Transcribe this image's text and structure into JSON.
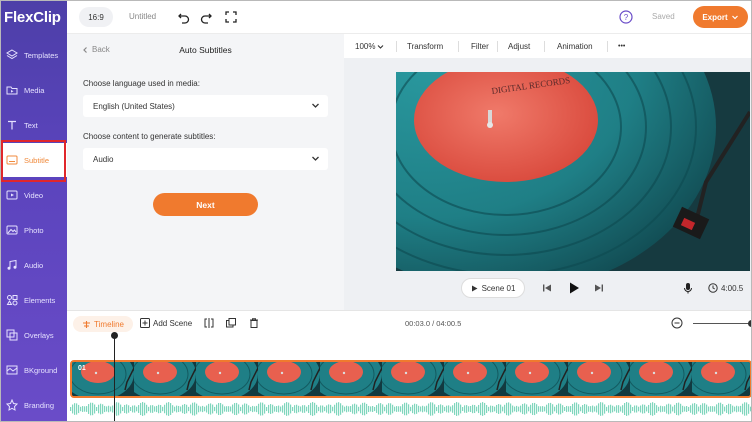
{
  "app": {
    "logo_text": "FlexClip"
  },
  "sidebar": {
    "items": [
      {
        "label": "Templates",
        "icon": "layers-icon"
      },
      {
        "label": "Media",
        "icon": "folder-icon"
      },
      {
        "label": "Text",
        "icon": "text-icon"
      },
      {
        "label": "Subtitle",
        "icon": "subtitle-icon",
        "active": true
      },
      {
        "label": "Video",
        "icon": "video-icon"
      },
      {
        "label": "Photo",
        "icon": "photo-icon"
      },
      {
        "label": "Audio",
        "icon": "music-icon"
      },
      {
        "label": "Elements",
        "icon": "elements-icon"
      },
      {
        "label": "Overlays",
        "icon": "overlays-icon"
      },
      {
        "label": "BKground",
        "icon": "background-icon"
      },
      {
        "label": "Branding",
        "icon": "branding-icon"
      }
    ]
  },
  "topbar": {
    "ratio": "16:9",
    "project_title": "Untitled",
    "saved_label": "Saved",
    "export_label": "Export"
  },
  "panel": {
    "back_label": "Back",
    "title": "Auto Subtitles",
    "language_label": "Choose language used in media:",
    "language_value": "English (United States)",
    "content_label": "Choose content to generate subtitles:",
    "content_value": "Audio",
    "next_label": "Next"
  },
  "preview_tools": {
    "zoom": "100%",
    "transform": "Transform",
    "filter": "Filter",
    "adjust": "Adjust",
    "animation": "Animation",
    "more": "•••"
  },
  "preview": {
    "record_label_text": "DIGITAL RECORDS",
    "scene_label": "Scene 01",
    "duration": "4:00.5"
  },
  "timeline": {
    "timeline_label": "Timeline",
    "add_scene_label": "Add Scene",
    "time_readout": "00:03.0 / 04:00.5",
    "clip_number": "01"
  },
  "colors": {
    "accent": "#f07a2e",
    "sidebar": "#5b44bd",
    "highlight": "#e0262b",
    "record_label": "#e8604f",
    "vinyl": "#1f7f86"
  }
}
